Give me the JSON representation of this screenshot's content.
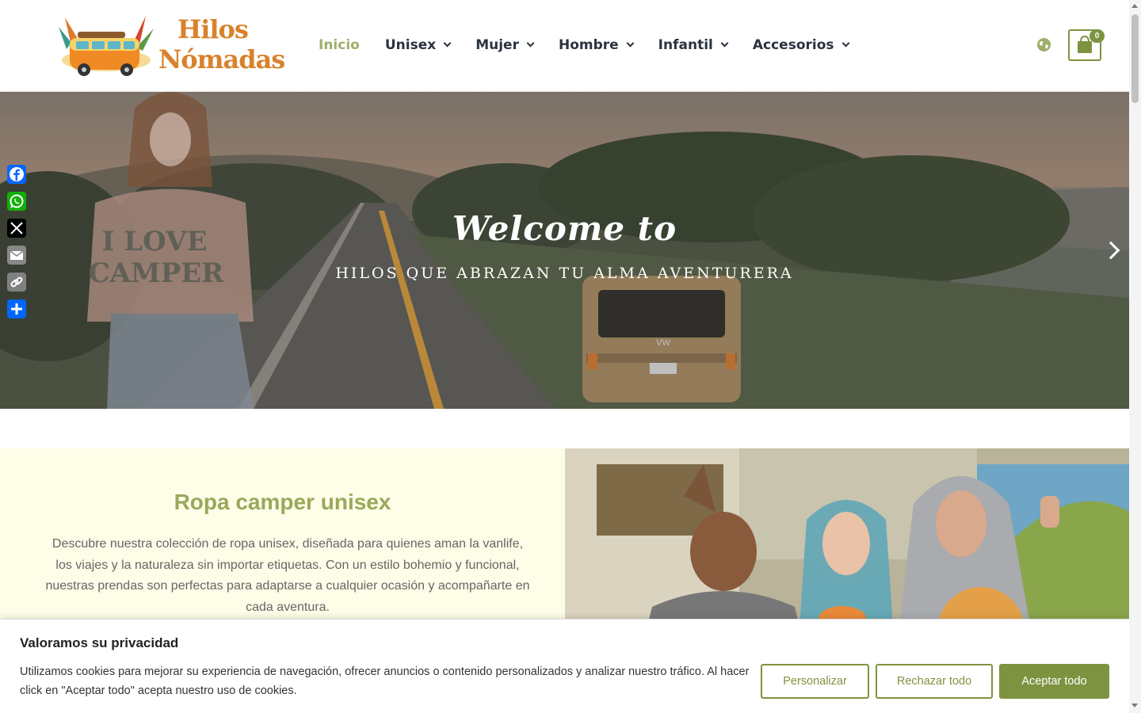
{
  "brand": {
    "logo_line1": "Hilos",
    "logo_line2": "Nómadas"
  },
  "nav": {
    "items": [
      {
        "label": "Inicio",
        "active": true,
        "dropdown": false
      },
      {
        "label": "Unisex",
        "active": false,
        "dropdown": true
      },
      {
        "label": "Mujer",
        "active": false,
        "dropdown": true
      },
      {
        "label": "Hombre",
        "active": false,
        "dropdown": true
      },
      {
        "label": "Infantil",
        "active": false,
        "dropdown": true
      },
      {
        "label": "Accesorios",
        "active": false,
        "dropdown": true
      }
    ]
  },
  "header": {
    "cart_count": "0",
    "globe_icon": "globe-icon",
    "cart_icon": "shopping-bag-icon"
  },
  "share": {
    "buttons": [
      {
        "name": "facebook",
        "color": "#0866ff",
        "icon": "facebook-icon"
      },
      {
        "name": "whatsapp",
        "color": "#12af0a",
        "icon": "whatsapp-icon"
      },
      {
        "name": "x",
        "color": "#000000",
        "icon": "x-icon"
      },
      {
        "name": "email",
        "color": "#888888",
        "icon": "email-icon"
      },
      {
        "name": "copy-link",
        "color": "#808080",
        "icon": "link-icon"
      },
      {
        "name": "share",
        "color": "#0166ff",
        "icon": "plus-icon"
      }
    ]
  },
  "hero": {
    "title": "Welcome to",
    "subtitle": "HILOS QUE ABRAZAN TU ALMA AVENTURERA",
    "shirt_text_1": "I LOVE",
    "shirt_text_2": "CAMPER",
    "plate": "VW"
  },
  "section": {
    "title": "Ropa camper unisex",
    "text": "Descubre nuestra colección de ropa unisex, diseñada para quienes aman la vanlife, los viajes y la naturaleza sin importar etiquetas. Con un estilo bohemio y funcional, nuestras prendas son perfectas para adaptarse a cualquier ocasión y acompañarte en cada aventura."
  },
  "cookie": {
    "title": "Valoramos su privacidad",
    "text": "Utilizamos cookies para mejorar su experiencia de navegación, ofrecer anuncios o contenido personalizados y analizar nuestro tráfico. Al hacer click en \"Aceptar todo\" acepta nuestro uso de cookies.",
    "customize": "Personalizar",
    "reject": "Rechazar todo",
    "accept": "Aceptar todo"
  },
  "colors": {
    "accent": "#7e9340",
    "nav_active": "#9fae6a",
    "section_bg": "#fdfde8",
    "section_title": "#9aa85a"
  }
}
